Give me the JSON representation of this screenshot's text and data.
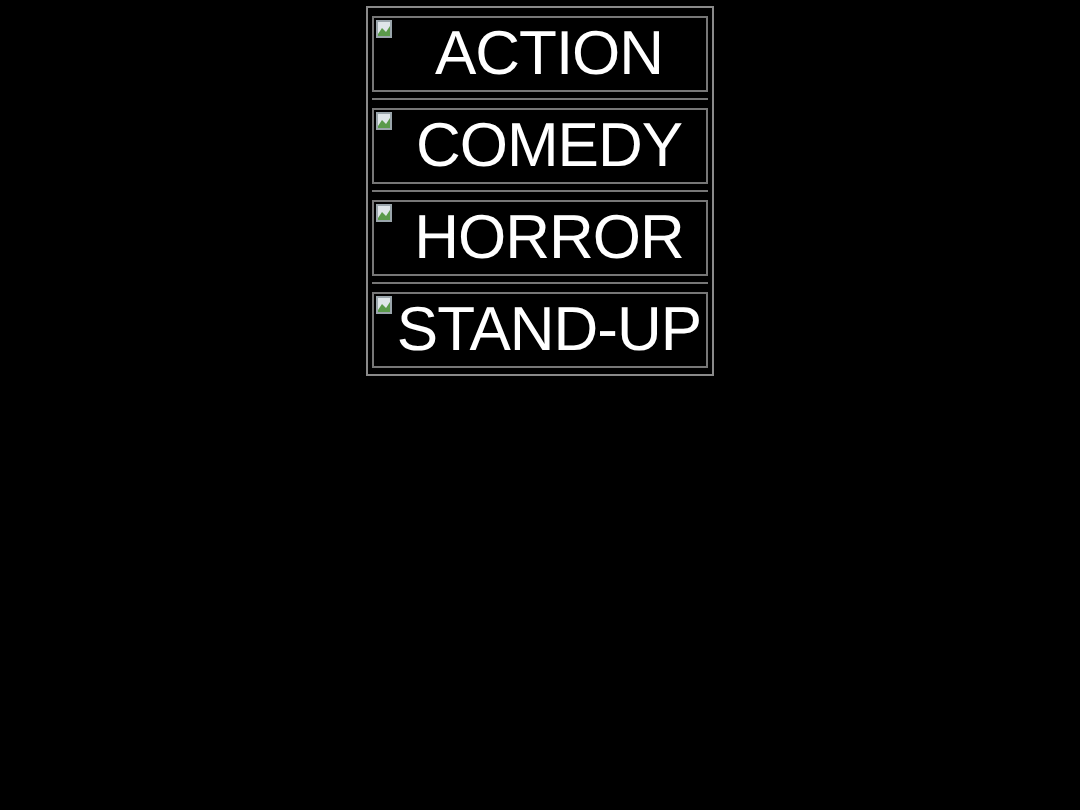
{
  "categories": [
    {
      "label": "ACTION"
    },
    {
      "label": "COMEDY"
    },
    {
      "label": "HORROR"
    },
    {
      "label": "STAND-UP"
    }
  ]
}
